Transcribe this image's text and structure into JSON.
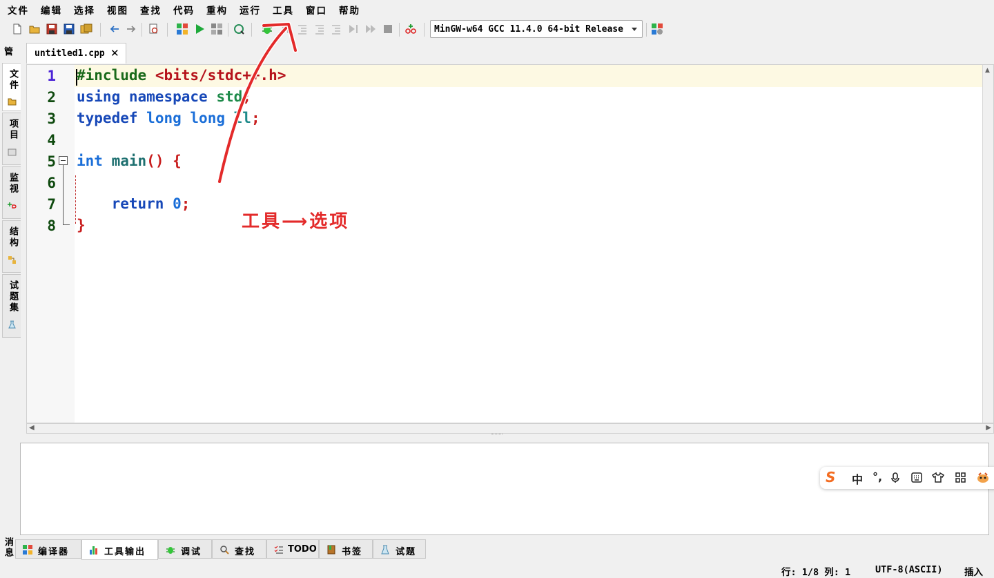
{
  "menu": [
    "文件",
    "编辑",
    "选择",
    "视图",
    "查找",
    "代码",
    "重构",
    "运行",
    "工具",
    "窗口",
    "帮助"
  ],
  "toolbar": {
    "compiler": "MinGW-w64 GCC 11.4.0 64-bit Release"
  },
  "left_tabs": {
    "manage": "管",
    "files": "文件",
    "project": "项目",
    "watch": "监视",
    "structure": "结构",
    "problemset": "试题集"
  },
  "editor": {
    "tab_name": "untitled1.cpp",
    "tab_close": "✕",
    "line_numbers": [
      "1",
      "2",
      "3",
      "4",
      "5",
      "6",
      "7",
      "8"
    ],
    "lines": {
      "l1_pre": "#include",
      "l1_inc": "<bits/stdc++.h>",
      "l2_kw1": "using",
      "l2_kw2": "namespace",
      "l2_id": "std",
      "semi": ";",
      "l3_kw1": "typedef",
      "l3_kw2": "long",
      "l3_kw3": "long",
      "l3_id": "ll",
      "l5_kw": "int",
      "l5_fn": "main",
      "l5_paren": "()",
      "l5_brace": "{",
      "l7_kw": "return",
      "l7_num": "0",
      "l8_brace": "}"
    }
  },
  "ime": {
    "logo": "S",
    "mode": "中",
    "punct": "°,"
  },
  "bottom_tabs": [
    "编译器",
    "工具输出",
    "调试",
    "查找",
    "TODO",
    "书签",
    "试题"
  ],
  "messages_label": "消息",
  "status": {
    "position": "行: 1/8 列: 1",
    "encoding": "UTF-8(ASCII)",
    "mode": "插入"
  },
  "annotation": {
    "text": "工具⟶选项",
    "color": "#e32a2a"
  }
}
